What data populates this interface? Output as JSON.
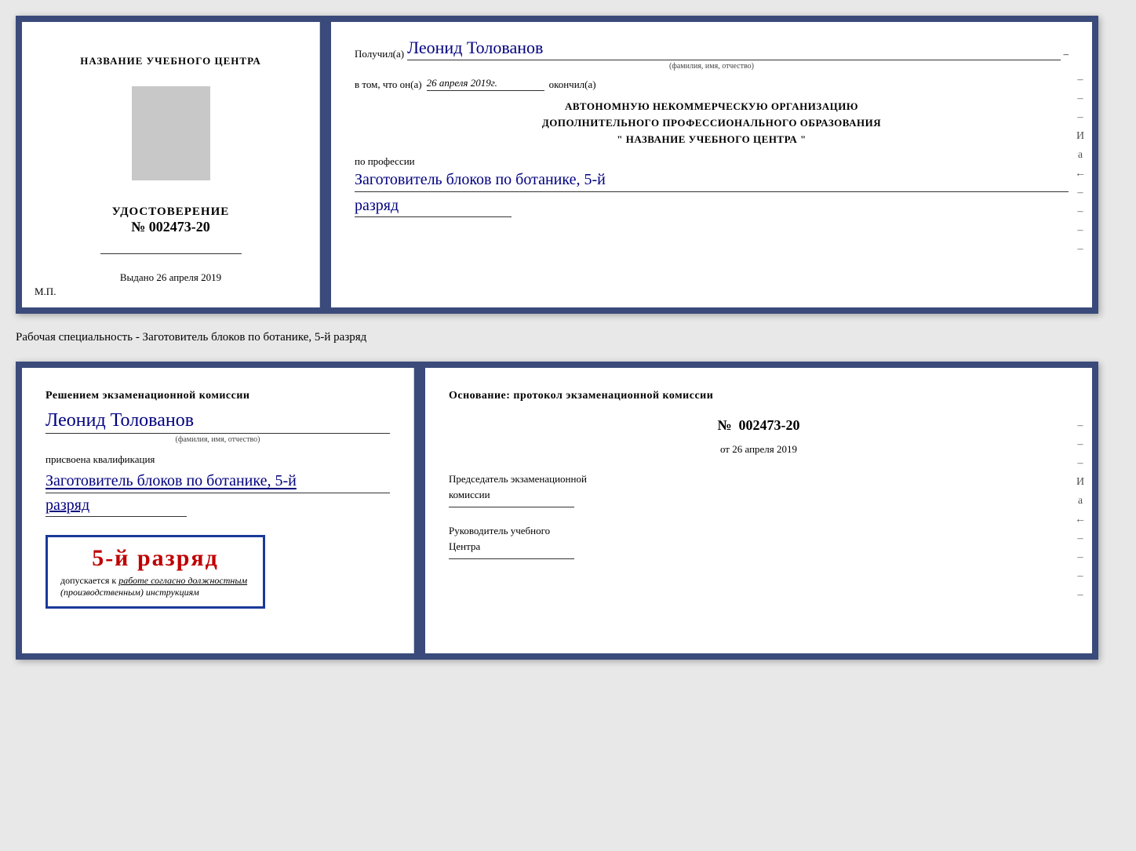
{
  "cert": {
    "left": {
      "title": "НАЗВАНИЕ УЧЕБНОГО ЦЕНТРА",
      "udostoverenie": "УДОСТОВЕРЕНИЕ",
      "number_label": "№",
      "number": "002473-20",
      "vydano_label": "Выдано",
      "vydano_date": "26 апреля 2019",
      "mp": "М.П."
    },
    "right": {
      "poluchil_label": "Получил(а)",
      "recipient_name": "Леонид Толованов",
      "fio_label": "(фамилия, имя, отчество)",
      "vtom_label": "в том, что он(а)",
      "vtom_date": "26 апреля 2019г.",
      "okonchil": "окончил(а)",
      "org_line1": "АВТОНОМНУЮ НЕКОММЕРЧЕСКУЮ ОРГАНИЗАЦИЮ",
      "org_line2": "ДОПОЛНИТЕЛЬНОГО ПРОФЕССИОНАЛЬНОГО ОБРАЗОВАНИЯ",
      "org_line3": "\" НАЗВАНИЕ УЧЕБНОГО ЦЕНТРА \"",
      "po_professii": "по профессии",
      "profession": "Заготовитель блоков по ботанике, 5-й",
      "razryad": "разряд"
    }
  },
  "specialty_label": "Рабочая специальность - Заготовитель блоков по ботанике, 5-й разряд",
  "qual": {
    "left": {
      "heading": "Решением экзаменационной комиссии",
      "name": "Леонид Толованов",
      "fio_label": "(фамилия, имя, отчество)",
      "prisvoena": "присвоена квалификация",
      "profession": "Заготовитель блоков по ботанике, 5-й",
      "razryad": "разряд",
      "dopuskaetsya": "допускается к",
      "rabota": "работе согласно должностным",
      "instruktsii": "(производственным) инструкциям",
      "badge_text": "5-й разряд"
    },
    "right": {
      "osnovanie": "Основание: протокол экзаменационной комиссии",
      "number_label": "№",
      "number": "002473-20",
      "ot_label": "от",
      "ot_date": "26 апреля 2019",
      "predsedatel_line1": "Председатель экзаменационной",
      "predsedatel_line2": "комиссии",
      "rukovoditel_line1": "Руководитель учебного",
      "rukovoditel_line2": "Центра"
    }
  },
  "dashes": [
    "-",
    "-",
    "-",
    "И",
    "а",
    "←",
    "-",
    "-",
    "-",
    "-"
  ]
}
